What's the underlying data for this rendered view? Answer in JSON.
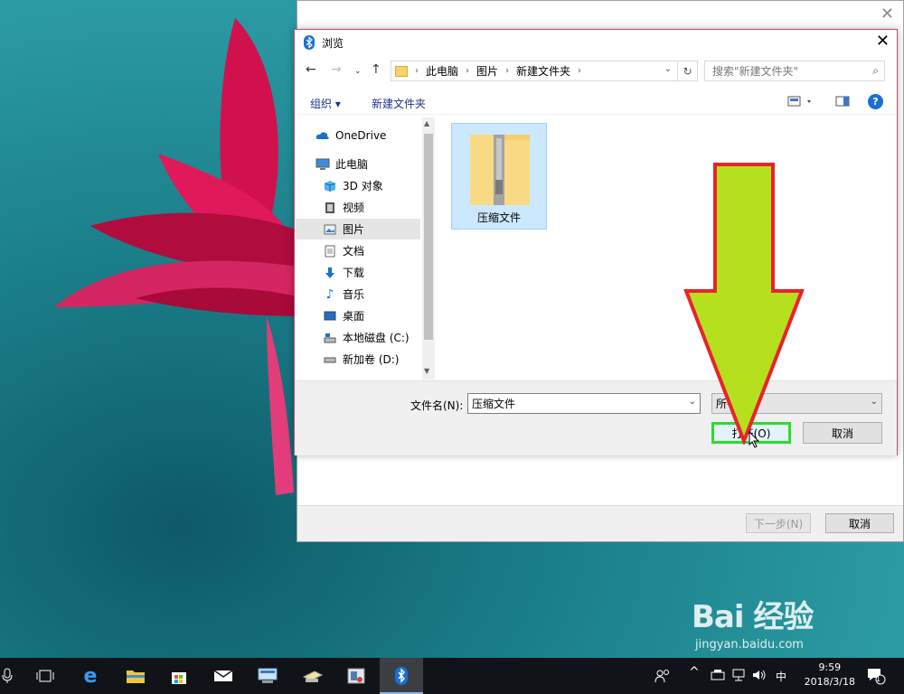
{
  "dialog": {
    "title": "浏览",
    "close_glyph": "✕",
    "breadcrumb": [
      "此电脑",
      "图片",
      "新建文件夹"
    ],
    "search_placeholder": "搜索\"新建文件夹\"",
    "toolbar": {
      "organize": "组织 ▾",
      "new_folder": "新建文件夹",
      "help": "?"
    },
    "nav_items": [
      {
        "label": "OneDrive",
        "icon": "cloud-icon",
        "selected": false
      },
      {
        "label": "此电脑",
        "icon": "computer-icon",
        "selected": false
      },
      {
        "label": "3D 对象",
        "icon": "3d-objects-icon",
        "selected": false
      },
      {
        "label": "视频",
        "icon": "video-icon",
        "selected": false
      },
      {
        "label": "图片",
        "icon": "pictures-icon",
        "selected": true
      },
      {
        "label": "文档",
        "icon": "documents-icon",
        "selected": false
      },
      {
        "label": "下载",
        "icon": "download-icon",
        "selected": false
      },
      {
        "label": "音乐",
        "icon": "music-icon",
        "selected": false
      },
      {
        "label": "桌面",
        "icon": "desktop-icon",
        "selected": false
      },
      {
        "label": "本地磁盘 (C:)",
        "icon": "drive-c-icon",
        "selected": false
      },
      {
        "label": "新加卷 (D:)",
        "icon": "drive-d-icon",
        "selected": false
      }
    ],
    "files": [
      {
        "name": "压缩文件",
        "icon": "zip-folder-icon",
        "selected": true
      }
    ],
    "filename_label": "文件名(N):",
    "filename_value": "压缩文件",
    "filetype_value": "所有文件",
    "open_button": "打开(O)",
    "cancel_button": "取消"
  },
  "background_window": {
    "next_button": "下一步(N)",
    "cancel_button": "取消"
  },
  "taskbar": {
    "ime": "中",
    "time": "9:59",
    "date": "2018/3/18",
    "notification_count": "1"
  },
  "watermark": {
    "main": "Bai 经验",
    "sub": "jingyan.baidu.com"
  },
  "colors": {
    "arrow_fill": "#b5e01e",
    "arrow_stroke": "#e8232a",
    "highlight_box": "#2bdc2b",
    "dialog_border": "#c9497a"
  }
}
